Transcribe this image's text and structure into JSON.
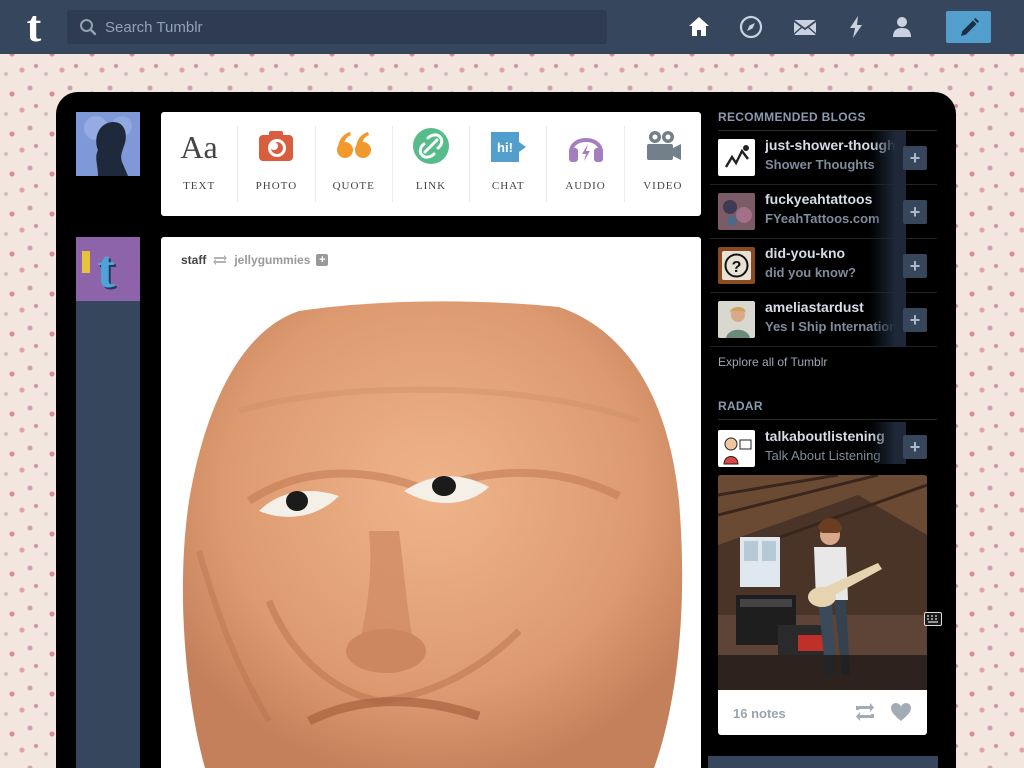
{
  "header": {
    "logo": "t",
    "search_placeholder": "Search Tumblr",
    "nav": [
      "home-icon",
      "explore-icon",
      "inbox-icon",
      "activity-icon",
      "account-icon"
    ],
    "compose_icon": "pencil-icon"
  },
  "post_types": [
    {
      "label": "TEXT",
      "icon": "text-icon",
      "color": "#444444",
      "glyph": "Aa"
    },
    {
      "label": "PHOTO",
      "icon": "camera-icon",
      "color": "#d95e40"
    },
    {
      "label": "QUOTE",
      "icon": "quote-icon",
      "color": "#f2992e",
      "glyph": "“"
    },
    {
      "label": "LINK",
      "icon": "link-icon",
      "color": "#56bc8a"
    },
    {
      "label": "CHAT",
      "icon": "chat-icon",
      "color": "#529ecc",
      "glyph": "hi!"
    },
    {
      "label": "AUDIO",
      "icon": "headphones-icon",
      "color": "#a77dc2"
    },
    {
      "label": "VIDEO",
      "icon": "video-camera-icon",
      "color": "#748089"
    }
  ],
  "post": {
    "author": "staff",
    "reblogged_from": "jellygummies"
  },
  "sidebar": {
    "recommended_heading": "RECOMMENDED BLOGS",
    "blogs": [
      {
        "name": "just-shower-thoughts",
        "title": "Shower Thoughts"
      },
      {
        "name": "fuckyeahtattoos",
        "title": "FYeahTattoos.com"
      },
      {
        "name": "did-you-kno",
        "title": "did you know?"
      },
      {
        "name": "ameliastardust",
        "title": "Yes I Ship International"
      }
    ],
    "follow_label": "+",
    "explore_link": "Explore all of Tumblr",
    "radar_heading": "RADAR",
    "radar": {
      "name": "talkaboutlistening",
      "title": "Talk About Listening",
      "notes": "16 notes"
    }
  },
  "colors": {
    "header": "#36465d",
    "compose": "#529ecc"
  }
}
